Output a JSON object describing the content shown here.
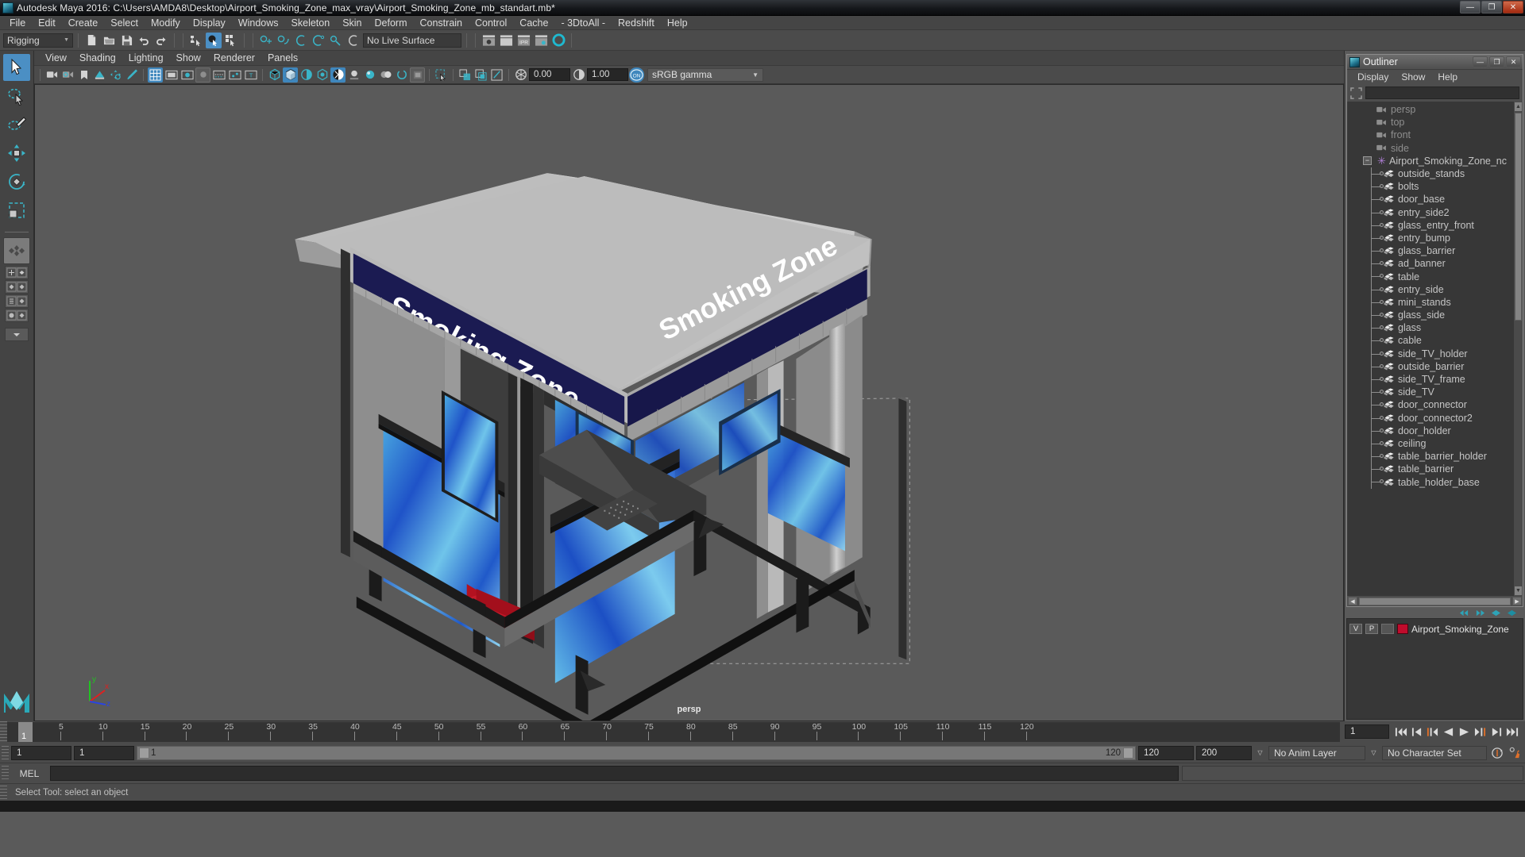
{
  "titlebar": {
    "text": "Autodesk Maya 2016: C:\\Users\\AMDA8\\Desktop\\Airport_Smoking_Zone_max_vray\\Airport_Smoking_Zone_mb_standart.mb*",
    "minimize": "—",
    "maximize": "❐",
    "close": "✕"
  },
  "menubar": {
    "items": [
      "File",
      "Edit",
      "Create",
      "Select",
      "Modify",
      "Display",
      "Windows",
      "Skeleton",
      "Skin",
      "Deform",
      "Constrain",
      "Control",
      "Cache",
      "- 3DtoAll -",
      "Redshift",
      "Help"
    ]
  },
  "toolbar": {
    "menuset": "Rigging",
    "live_surface": "No Live Surface"
  },
  "viewport_menu": {
    "items": [
      "View",
      "Shading",
      "Lighting",
      "Show",
      "Renderer",
      "Panels"
    ]
  },
  "viewport_tools": {
    "exposure_value": "0.00",
    "gamma_value": "1.00",
    "color_management_toggle": "ON",
    "color_profile": "sRGB gamma"
  },
  "viewport": {
    "camera_label": "persp",
    "axis_labels": {
      "x": "x",
      "y": "y",
      "z": "z"
    },
    "model": {
      "banner_text": "Smoking Zone",
      "banner_color": "#1b1b52",
      "roof_color": "#b5b5b5",
      "glass_blue": "#2b6fd0",
      "accent_red": "#b31220",
      "frame_dark": "#2a2a2a"
    }
  },
  "outliner": {
    "title": "Outliner",
    "win_buttons": {
      "minimize": "—",
      "maximize": "❐",
      "close": "✕"
    },
    "menu": [
      "Display",
      "Show",
      "Help"
    ],
    "search_value": "",
    "cameras": [
      "persp",
      "top",
      "front",
      "side"
    ],
    "group": "Airport_Smoking_Zone_nc",
    "children": [
      "outside_stands",
      "bolts",
      "door_base",
      "entry_side2",
      "glass_entry_front",
      "entry_bump",
      "glass_barrier",
      "ad_banner",
      "table",
      "entry_side",
      "mini_stands",
      "glass_side",
      "glass",
      "cable",
      "side_TV_holder",
      "outside_barrier",
      "side_TV_frame",
      "side_TV",
      "door_connector",
      "door_connector2",
      "door_holder",
      "ceiling",
      "table_barrier_holder",
      "table_barrier",
      "table_holder_base"
    ]
  },
  "layer_editor": {
    "headers": {
      "visibility": "V",
      "playback": "P"
    },
    "layers": [
      {
        "visibility": "V",
        "playback": "P",
        "color": "#c00c2c",
        "name": "Airport_Smoking_Zone"
      }
    ]
  },
  "timeline": {
    "current_frame": "1",
    "ticks": [
      5,
      10,
      15,
      20,
      25,
      30,
      35,
      40,
      45,
      50,
      55,
      60,
      65,
      70,
      75,
      80,
      85,
      90,
      95,
      100,
      105,
      110,
      115,
      120
    ],
    "frame_field": "1",
    "range_start": "1",
    "range_end": "1",
    "range_bar_start": "1",
    "range_bar_end": "120",
    "playback_end": "120",
    "anim_end": "200",
    "anim_layer": "No Anim Layer",
    "character_set": "No Character Set"
  },
  "command_line": {
    "language": "MEL",
    "input_value": "",
    "output_value": ""
  },
  "statusbar": {
    "message": "Select Tool: select an object"
  }
}
